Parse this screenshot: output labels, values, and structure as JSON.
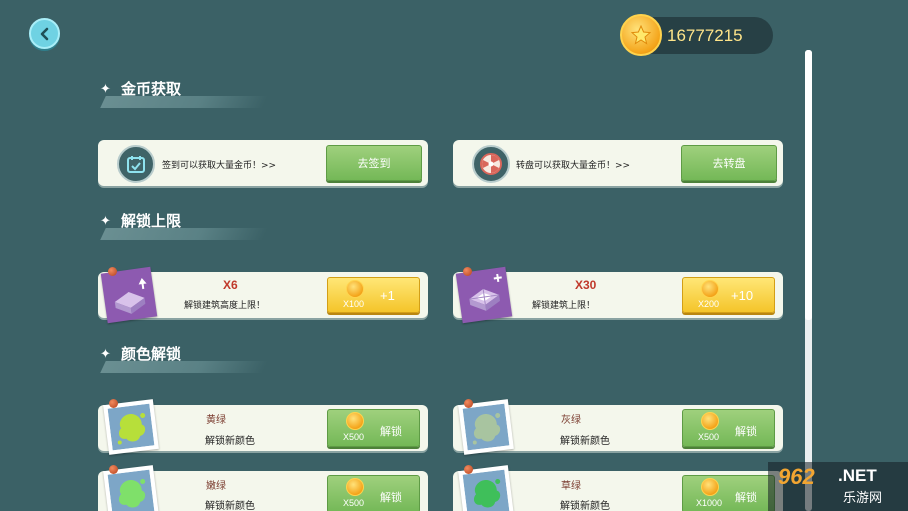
{
  "header": {
    "coins": "16777215"
  },
  "sections": {
    "coins": {
      "title": "金币获取"
    },
    "limit": {
      "title": "解锁上限"
    },
    "colors": {
      "title": "颜色解锁"
    }
  },
  "coin_cards": [
    {
      "text": "签到可以获取大量金币！>>",
      "button": "去签到",
      "icon": "calendar-check-icon"
    },
    {
      "text": "转盘可以获取大量金币！>>",
      "button": "去转盘",
      "icon": "spin-wheel-icon"
    }
  ],
  "limit_cards": [
    {
      "count": "X6",
      "desc": "解锁建筑高度上限！",
      "price": "X100",
      "plus": "+1"
    },
    {
      "count": "X30",
      "desc": "解锁建筑上限！",
      "price": "X200",
      "plus": "+10"
    }
  ],
  "color_cards": [
    {
      "name": "黄绿",
      "desc": "解锁新颜色",
      "price": "X500",
      "button": "解锁",
      "swatch": "#b7df3a"
    },
    {
      "name": "灰绿",
      "desc": "解锁新颜色",
      "price": "X500",
      "button": "解锁",
      "swatch": "#a8c4a0"
    },
    {
      "name": "嫩绿",
      "desc": "解锁新颜色",
      "price": "X500",
      "button": "解锁",
      "swatch": "#7fe06a"
    },
    {
      "name": "草绿",
      "desc": "解锁新颜色",
      "price": "X1000",
      "button": "解锁",
      "swatch": "#3fbf5a"
    }
  ],
  "watermark": {
    "logo": "962",
    "net": ".NET",
    "cn": "乐游网"
  },
  "colors": {
    "background": "#3b6166",
    "card": "#f4f7ec",
    "accent_green": "#74b857",
    "accent_yellow": "#f4c52a"
  }
}
